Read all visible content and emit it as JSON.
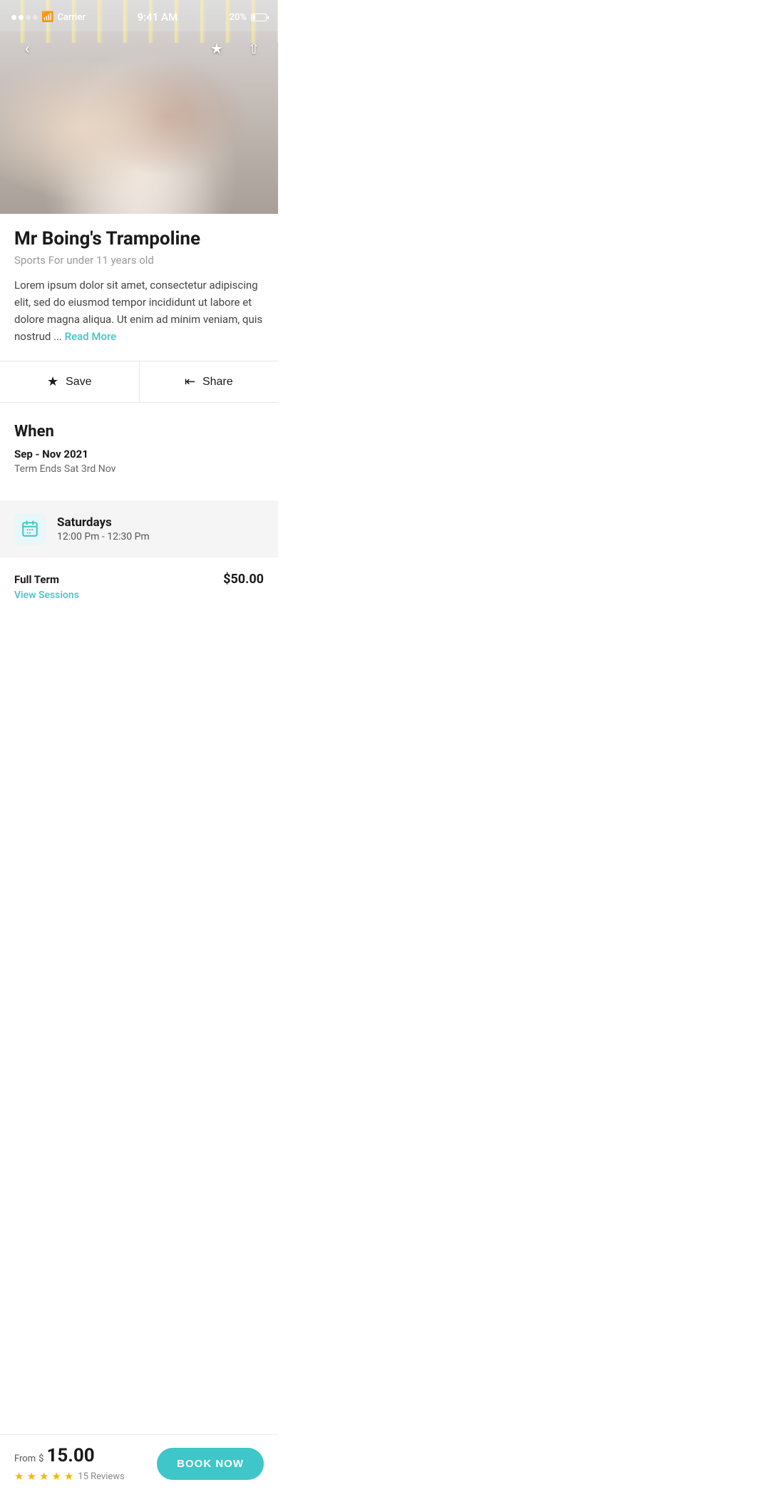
{
  "status_bar": {
    "carrier": "Carrier",
    "time": "9:41 AM",
    "battery_percent": "20%"
  },
  "nav": {
    "back_icon": "‹",
    "bookmark_icon": "★",
    "share_icon": "⤴"
  },
  "activity": {
    "title": "Mr Boing's Trampoline",
    "subtitle": "Sports For under 11 years old",
    "description": "Lorem ipsum dolor sit amet, consectetur adipiscing elit, sed do eiusmod tempor incididunt ut labore et dolore magna aliqua. Ut enim ad minim veniam, quis nostrud ...",
    "read_more_label": "Read More"
  },
  "actions": {
    "save_label": "Save",
    "share_label": "Share"
  },
  "when_section": {
    "heading": "When",
    "date_range": "Sep - Nov 2021",
    "term_ends": "Term Ends Sat 3rd Nov",
    "schedule": {
      "day": "Saturdays",
      "time": "12:00 Pm - 12:30 Pm"
    },
    "pricing": {
      "label": "Full Term",
      "amount": "$50.00",
      "view_sessions_label": "View Sessions"
    }
  },
  "bottom_bar": {
    "from_label": "From",
    "currency_symbol": "$",
    "price": "15.00",
    "stars": 5,
    "reviews_count": "15 Reviews",
    "book_now_label": "BOOK NOW"
  }
}
